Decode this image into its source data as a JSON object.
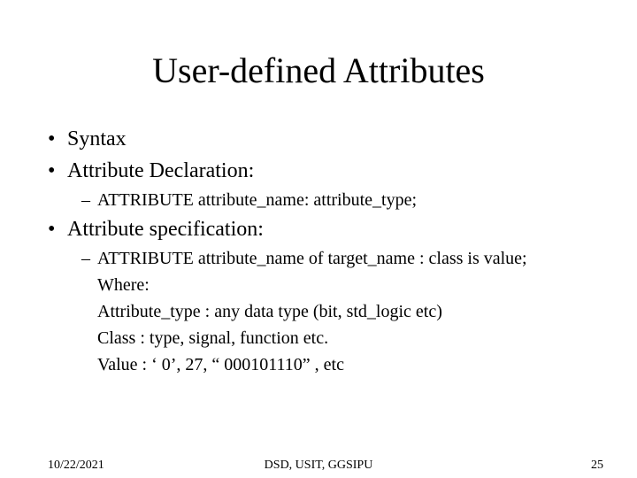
{
  "title": "User-defined Attributes",
  "bullets": {
    "syntax": "Syntax",
    "attr_decl": "Attribute Declaration:",
    "attr_decl_sub": "ATTRIBUTE attribute_name: attribute_type;",
    "attr_spec": "Attribute specification:",
    "attr_spec_sub": "ATTRIBUTE attribute_name of target_name : class is value;",
    "where": "Where:",
    "where_type": "Attribute_type : any data type (bit, std_logic etc)",
    "where_class": "Class              : type, signal, function etc.",
    "where_value": "Value             : ‘ 0’, 27, “ 000101110” , etc"
  },
  "footer": {
    "date": "10/22/2021",
    "source": "DSD, USIT, GGSIPU",
    "page": "25"
  }
}
